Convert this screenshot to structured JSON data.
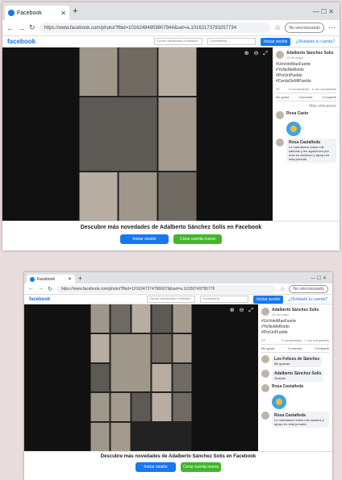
{
  "tab_title": "Facebook",
  "url1": "https://www.facebook.com/photo/?fbid=10162484859807944&set=a.10162173793257734",
  "url2": "https://www.facebook.com/photo/?fbid=10162472747960079&set=a.10150749795776",
  "account": "No sincronizando",
  "fb_logo": "facebook",
  "email_placeholder": "Correo electrónico o teléfono",
  "password_placeholder": "Contraseña",
  "login_label": "Iniciar sesión",
  "forgot_label": "¿Olvidaste tu cuenta?",
  "zoom_icons": "⊕ ⊖ ⤢",
  "post": {
    "author": "Adalberto Sánchez Solís",
    "time": "10 de mayo",
    "lines": [
      "#UnVotoMasFuerte",
      "#YoNoMeRindo",
      "#PorUnPueblo",
      "#CerdoDeMiPueblo"
    ],
    "reactions": "23",
    "comments": "3 comentarios · 1 vez compartido",
    "like": "Me gusta",
    "comment": "Comentar",
    "share": "Compartir",
    "relevance": "Más relevantes"
  },
  "comments1": [
    {
      "name": "Rosa Caste",
      "text": ""
    },
    {
      "name": "Rosa Castañeda",
      "text": "Le mandamos todos mis saludos y les agradezco por todo su esfuerzo y apoyo en esta jornada"
    }
  ],
  "comments2": [
    {
      "name": "Los Felices de Sánchez",
      "text": "Mil gracias"
    },
    {
      "name": "Adalberto Sánchez Solís",
      "text": "Gracias"
    },
    {
      "name": "Rosa Castañeda",
      "text": ""
    },
    {
      "name": "Rosa Castañeda",
      "text": "Le mandamos todos mis saludos y apoyo en esta jornada"
    }
  ],
  "bottom_title": "Descubre más novedades de Adalberto Sánchez Solís en Facebook",
  "bottom_login": "Iniciar sesión",
  "bottom_create": "Crear cuenta nueva"
}
